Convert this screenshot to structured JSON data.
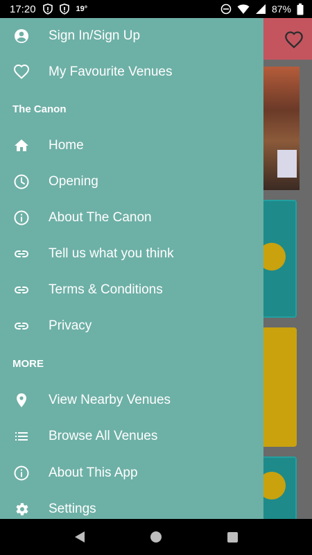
{
  "status_bar": {
    "time": "17:20",
    "temperature": "19°",
    "battery_percent": "87%",
    "icons": [
      "shield-icon",
      "shield-icon",
      "do-not-disturb-icon",
      "wifi-icon",
      "signal-icon",
      "battery-icon"
    ]
  },
  "drawer": {
    "account_items": [
      {
        "label": "Sign In/Sign Up",
        "icon": "account-circle-icon"
      },
      {
        "label": "My Favourite Venues",
        "icon": "heart-outline-icon"
      }
    ],
    "venue_section": {
      "title": "The Canon",
      "items": [
        {
          "label": "Home",
          "icon": "home-icon"
        },
        {
          "label": "Opening",
          "icon": "clock-icon"
        },
        {
          "label": "About The Canon",
          "icon": "info-icon"
        },
        {
          "label": "Tell us what you think",
          "icon": "link-icon"
        },
        {
          "label": "Terms & Conditions",
          "icon": "link-icon"
        },
        {
          "label": "Privacy",
          "icon": "link-icon"
        }
      ]
    },
    "more_section": {
      "title": "MORE",
      "items": [
        {
          "label": "View Nearby Venues",
          "icon": "location-pin-icon"
        },
        {
          "label": "Browse All Venues",
          "icon": "list-icon"
        },
        {
          "label": "About This App",
          "icon": "info-icon"
        },
        {
          "label": "Settings",
          "icon": "gear-icon"
        }
      ]
    }
  },
  "colors": {
    "drawer_bg": "#6db0a6",
    "header_bg": "#c4555f",
    "text": "#ffffff"
  }
}
